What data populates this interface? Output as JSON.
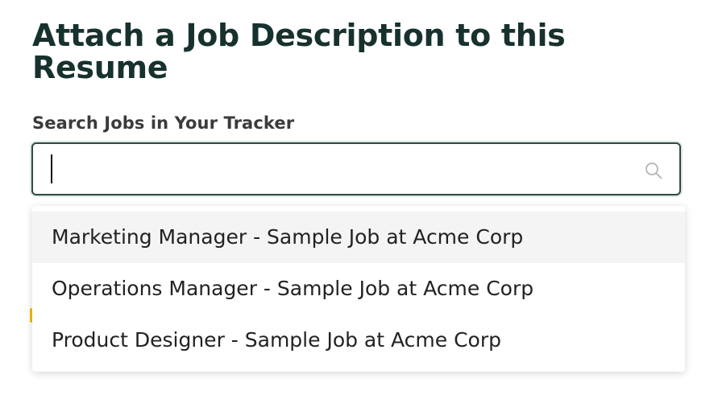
{
  "dialog": {
    "title": "Attach a Job Description to this Resume"
  },
  "search": {
    "label": "Search Jobs in Your Tracker",
    "value": "",
    "icon": "search-icon"
  },
  "dropdown": {
    "options": [
      {
        "label": "Marketing Manager - Sample Job at Acme Corp",
        "highlighted": true
      },
      {
        "label": "Operations Manager - Sample Job at Acme Corp",
        "highlighted": false
      },
      {
        "label": "Product Designer - Sample Job at Acme Corp",
        "highlighted": false
      }
    ]
  },
  "colors": {
    "title": "#17312e",
    "input_border": "#2e4a45",
    "highlight_bg": "#f4f4f4",
    "accent_mark": "#f0c000"
  }
}
